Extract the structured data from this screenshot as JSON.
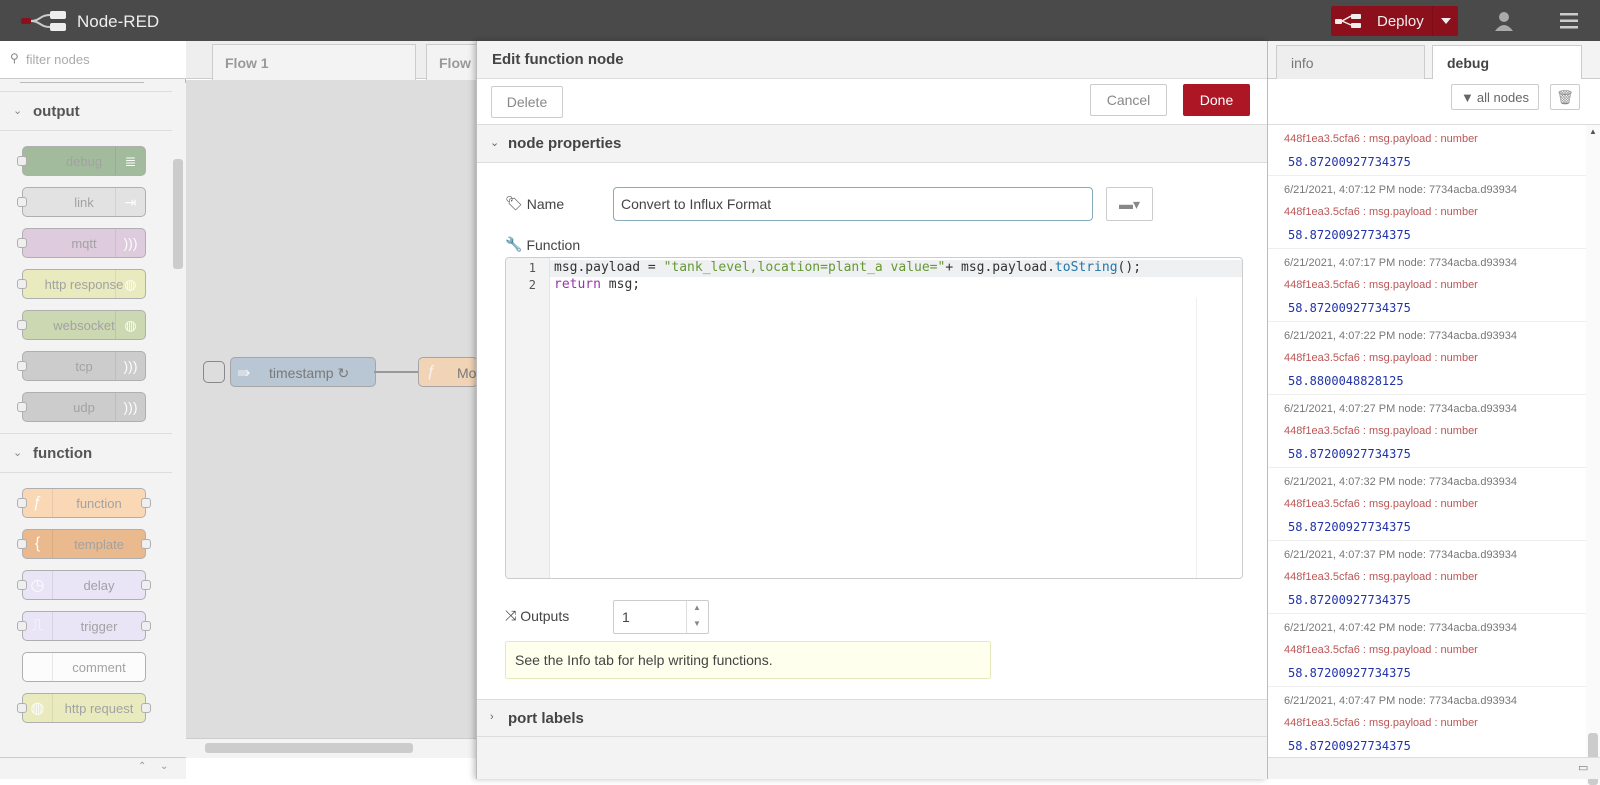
{
  "app": {
    "title": "Node-RED"
  },
  "header": {
    "deploy_label": "Deploy",
    "colors": {
      "deploy_bg": "#8c101c",
      "header_bg": "#4a4a4a"
    }
  },
  "palette": {
    "filter_placeholder": "filter nodes",
    "categories": [
      {
        "label": "output",
        "nodes": [
          "debug",
          "link",
          "mqtt",
          "http response",
          "websocket",
          "tcp",
          "udp"
        ]
      },
      {
        "label": "function",
        "nodes": [
          "function",
          "template",
          "delay",
          "trigger",
          "comment",
          "http request"
        ]
      }
    ]
  },
  "workspace": {
    "tabs": [
      "Flow 1",
      "Flow"
    ],
    "nodes": [
      {
        "label": "timestamp ↻"
      },
      {
        "label": "Mo"
      }
    ]
  },
  "editor": {
    "title": "Edit function node",
    "delete_label": "Delete",
    "cancel_label": "Cancel",
    "done_label": "Done",
    "section_props": "node properties",
    "name_label": "Name",
    "name_value": "Convert to Influx Format",
    "function_label": "Function",
    "code_lines": [
      {
        "num": "1",
        "text": "msg.payload = \"tank_level,location=plant_a value=\"+ msg.payload.toString();"
      },
      {
        "num": "2",
        "text": "return msg;"
      }
    ],
    "outputs_label": "Outputs",
    "outputs_value": "1",
    "tip": "See the Info tab for help writing functions.",
    "section_ports": "port labels"
  },
  "sidebar": {
    "tabs": [
      "info",
      "debug"
    ],
    "filter_label": "all nodes",
    "messages": [
      {
        "meta": "",
        "meta2": "448f1ea3.5cfa6 : msg.payload : number",
        "value": "58.87200927734375"
      },
      {
        "meta": "6/21/2021, 4:07:12 PM    node: 7734acba.d93934",
        "meta2": "448f1ea3.5cfa6 : msg.payload : number",
        "value": "58.87200927734375"
      },
      {
        "meta": "6/21/2021, 4:07:17 PM    node: 7734acba.d93934",
        "meta2": "448f1ea3.5cfa6 : msg.payload : number",
        "value": "58.87200927734375"
      },
      {
        "meta": "6/21/2021, 4:07:22 PM    node: 7734acba.d93934",
        "meta2": "448f1ea3.5cfa6 : msg.payload : number",
        "value": "58.8800048828125"
      },
      {
        "meta": "6/21/2021, 4:07:27 PM    node: 7734acba.d93934",
        "meta2": "448f1ea3.5cfa6 : msg.payload : number",
        "value": "58.87200927734375"
      },
      {
        "meta": "6/21/2021, 4:07:32 PM    node: 7734acba.d93934",
        "meta2": "448f1ea3.5cfa6 : msg.payload : number",
        "value": "58.87200927734375"
      },
      {
        "meta": "6/21/2021, 4:07:37 PM    node: 7734acba.d93934",
        "meta2": "448f1ea3.5cfa6 : msg.payload : number",
        "value": "58.87200927734375"
      },
      {
        "meta": "6/21/2021, 4:07:42 PM    node: 7734acba.d93934",
        "meta2": "448f1ea3.5cfa6 : msg.payload : number",
        "value": "58.87200927734375"
      },
      {
        "meta": "6/21/2021, 4:07:47 PM    node: 7734acba.d93934",
        "meta2": "448f1ea3.5cfa6 : msg.payload : number",
        "value": "58.87200927734375"
      }
    ]
  }
}
